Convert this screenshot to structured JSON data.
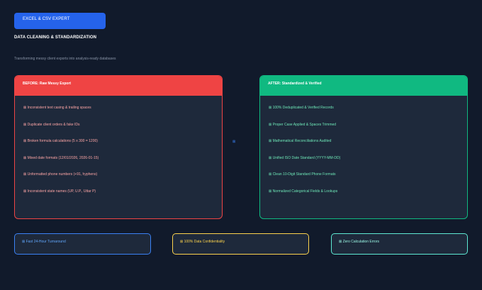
{
  "badge": {
    "label": "EXCEL & CSV EXPERT"
  },
  "header": {
    "title": "DATA CLEANING & STANDARDIZATION",
    "subtitle": "Transforming messy client exports into analysis-ready databases"
  },
  "before": {
    "title": "BEFORE: Raw Messy Export",
    "items": [
      "⊠ Inconsistent text casing & trailing spaces",
      "⊠ Duplicate client orders & fake IDs",
      "⊠ Broken formula calculations (5 x 300 = 1200)",
      "⊠ Mixed date formats (12/01/2026, 2026-01-15)",
      "⊠ Unformatted phone numbers (+91, hyphens)",
      "⊠ Inconsistent state names (UP, U.P., Uttar P)"
    ]
  },
  "transition": {
    "glyph": "⊠"
  },
  "after": {
    "title": "AFTER: Standardized & Verified",
    "items": [
      "⊠ 100% Deduplicated & Verified Records",
      "⊠ Proper Case Applied & Spaces Trimmed",
      "⊠ Mathematical Reconciliations Audited",
      "⊠ Unified ISO Date Standard (YYYY-MM-DD)",
      "⊠ Clean 10-Digit Standard Phone Formats",
      "⊠ Normalized Categorical Fields & Lookups"
    ]
  },
  "stats": [
    {
      "label": "⊠ Fast 24-Hour Turnaround"
    },
    {
      "label": "⊠ 100% Data Confidentiality"
    },
    {
      "label": "⊠ Zero Calculation Errors"
    }
  ],
  "colors": {
    "background": "#111a2b",
    "badge": "#2563eb",
    "before_accent": "#ef4444",
    "after_accent": "#10b981",
    "stat_blue": "#3b82f6",
    "stat_yellow": "#fcd34d",
    "stat_teal": "#5eead4"
  }
}
